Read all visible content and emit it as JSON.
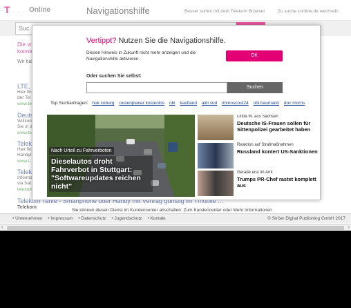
{
  "header": {
    "logo_mark": "T",
    "logo_dots": "· · ·",
    "logo_text": "Online",
    "title": "Navigationshilfe",
    "link_browser": "Besser surfen mit dem Telekom Browser",
    "link_suche": "Zu suche.t-online.de wechseln"
  },
  "background": {
    "search_value": "Suc",
    "alert_line1": "Die vo",
    "alert_line2": "konnte",
    "text_line": "Wir hal",
    "results": [
      {
        "title": "LTE, N",
        "desc1": "Hier fin",
        "desc2": "der Tel",
        "url": "www.te"
      },
      {
        "title": "Deuts",
        "desc1": "Willkom",
        "desc2": "Sie in d",
        "url": "www.tel"
      },
      {
        "title": "Teleko",
        "desc1": "Hier fin",
        "desc2": "Handyt",
        "url": "www.t-"
      },
      {
        "title": "Teleko",
        "desc1": "Informa",
        "desc2": "via Sat",
        "url": "telekom"
      }
    ],
    "bottom_link": "Telekom Tarife - Smartphone oder Handy mit Vertrag günstig im Tmobile ...",
    "bottom_desc": "Telekom",
    "notice": "Sie können diesen Dienst im Kundencenter abschalten: Zum Kundencenter oder Mehr Informationen"
  },
  "modal": {
    "title_accent": "Vertippt?",
    "title_rest": " Nutzen Sie die Navigationshilfe.",
    "hint": "Diesen Hinweis in Zukunft nicht mehr anzeigen und die Navigationshilfe aktivieren.",
    "ok_label": "OK",
    "or_search_label": "Oder suchen Sie selbst:",
    "search_value": "",
    "search_button": "Suchen",
    "top_searches_label": "Top Suchanfragen:",
    "top_searches": [
      "huk coburg",
      "routenplaner kostenlos",
      "obi",
      "kaufland",
      "aldi süd",
      "immoscout24",
      "obi baumarkt",
      "doc morris"
    ]
  },
  "hero": {
    "label": "Nach Urteil zu Fahrverboten",
    "headline": "Dieselautos droht Fahrverbot in Stuttgart: \"Softwareupdates reichen nicht\""
  },
  "news": [
    {
      "kicker": "Linda W. aus Sachsen",
      "title": "Deutsche IS-Frauen sollen für Sittenpolizei gearbeitet haben"
    },
    {
      "kicker": "Reaktion auf Strafmaßnahmen",
      "title": "Russland kontert US-Sanktionen"
    },
    {
      "kicker": "Gerade erst im Amt",
      "title": "Trumps PR-Chef rastet komplett aus"
    }
  ],
  "footer": {
    "links": [
      "• Unternehmen",
      "• Impressum",
      "• Datenschutz",
      "• Jugendschutz",
      "• Kontakt"
    ],
    "copyright": "© Ströer Digital Publishing GmbH 2017"
  },
  "scrollbar": {
    "left_arrow": "‹",
    "right_arrow": "›"
  },
  "colors": {
    "accent": "#e20074",
    "link": "#2046a0",
    "url": "#2a8a2a"
  }
}
